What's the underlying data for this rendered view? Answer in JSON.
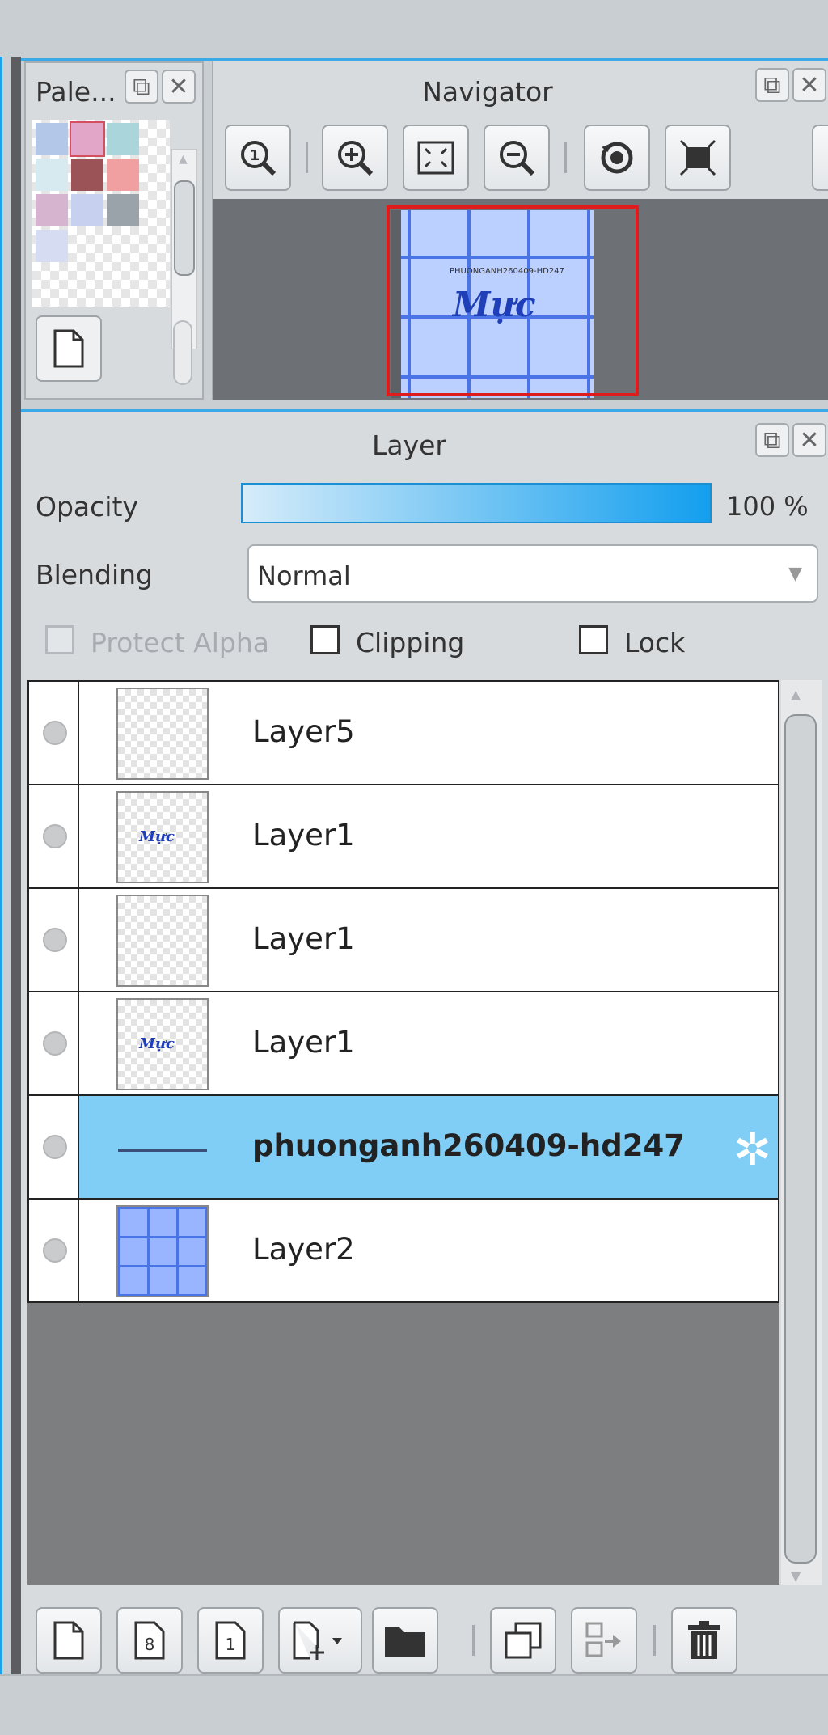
{
  "palette": {
    "title": "Pale...",
    "swatches": [
      "#b3c8e9",
      "#e2a6c9",
      "#a9d5db",
      "#d7eaf0",
      "#9b5358",
      "#f0a0a0",
      "#d6b3cf",
      "#c7d1ef",
      "#9aa3aa",
      "#d6dcf1"
    ]
  },
  "navigator": {
    "title": "Navigator",
    "canvas_caption": "PHUONGANH260409-HD247",
    "canvas_logo": "Mực"
  },
  "layer_panel": {
    "title": "Layer",
    "opacity_label": "Opacity",
    "opacity_value": "100 %",
    "opacity_percent": 100,
    "blending_label": "Blending",
    "blending_value": "Normal",
    "protect_alpha_label": "Protect Alpha",
    "clipping_label": "Clipping",
    "lock_label": "Lock",
    "thumb_logo": "Mực",
    "layers": [
      {
        "name": "Layer5"
      },
      {
        "name": "Layer1"
      },
      {
        "name": "Layer1"
      },
      {
        "name": "Layer1"
      },
      {
        "name": "phuonganh260409-hd247"
      },
      {
        "name": "Layer2"
      }
    ]
  },
  "colors": {
    "selected_row": "#80cdf5",
    "accent_border": "#3aa9e6",
    "navigator_frame": "#e01b1b"
  }
}
